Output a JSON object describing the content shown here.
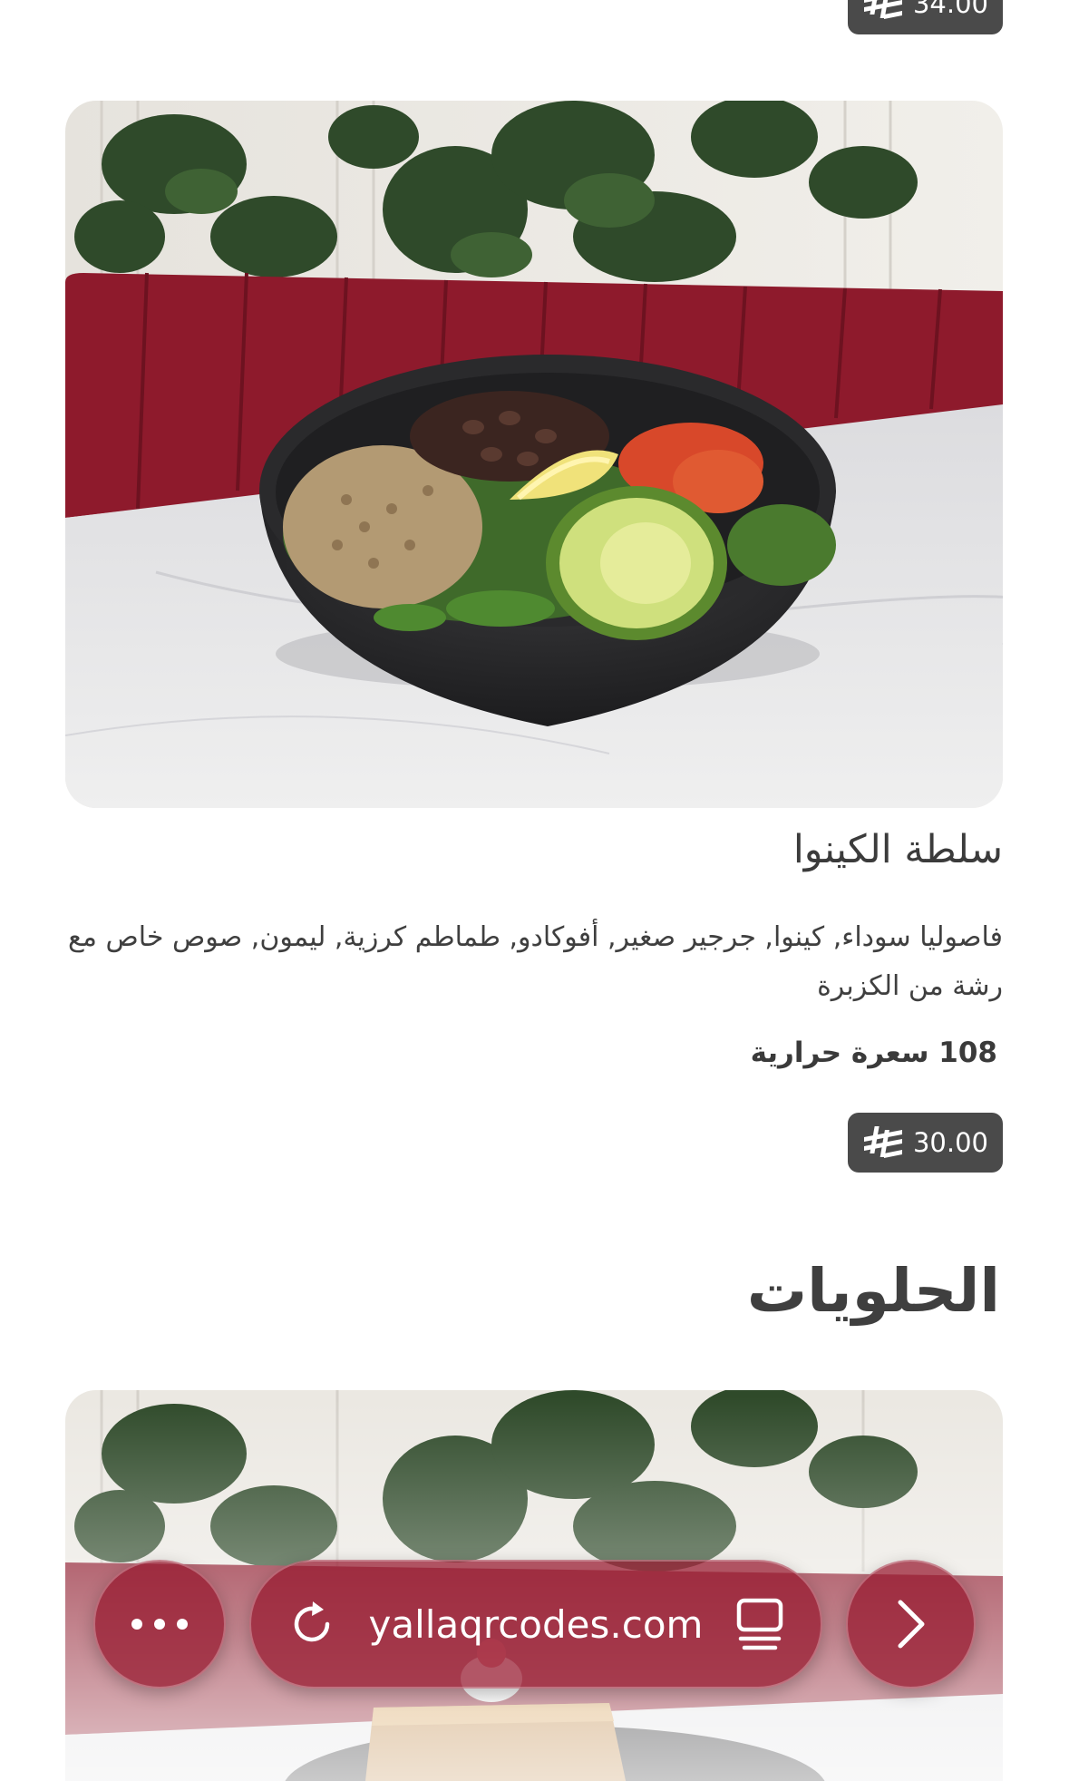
{
  "top_item": {
    "price": "34.00"
  },
  "item": {
    "title": "سلطة الكينوا",
    "description": "فاصوليا سوداء, كينوا, جرجير صغير, أفوكادو, طماطم كرزية, ليمون, صوص خاص مع رشة من الكزبرة",
    "calories": "108 سعرة حرارية",
    "price": "30.00",
    "currency_icon": "saudi-riyal-icon"
  },
  "section": {
    "title": "الحلويات"
  },
  "browser": {
    "url": "yallaqrcodes.com",
    "icons": [
      "more-icon",
      "reload-icon",
      "tabs-icon",
      "forward-icon"
    ]
  },
  "colors": {
    "badge_bg": "#4a4a4a",
    "toolbar_tint": "#96162d",
    "sofa_red": "#8e1a2c"
  }
}
